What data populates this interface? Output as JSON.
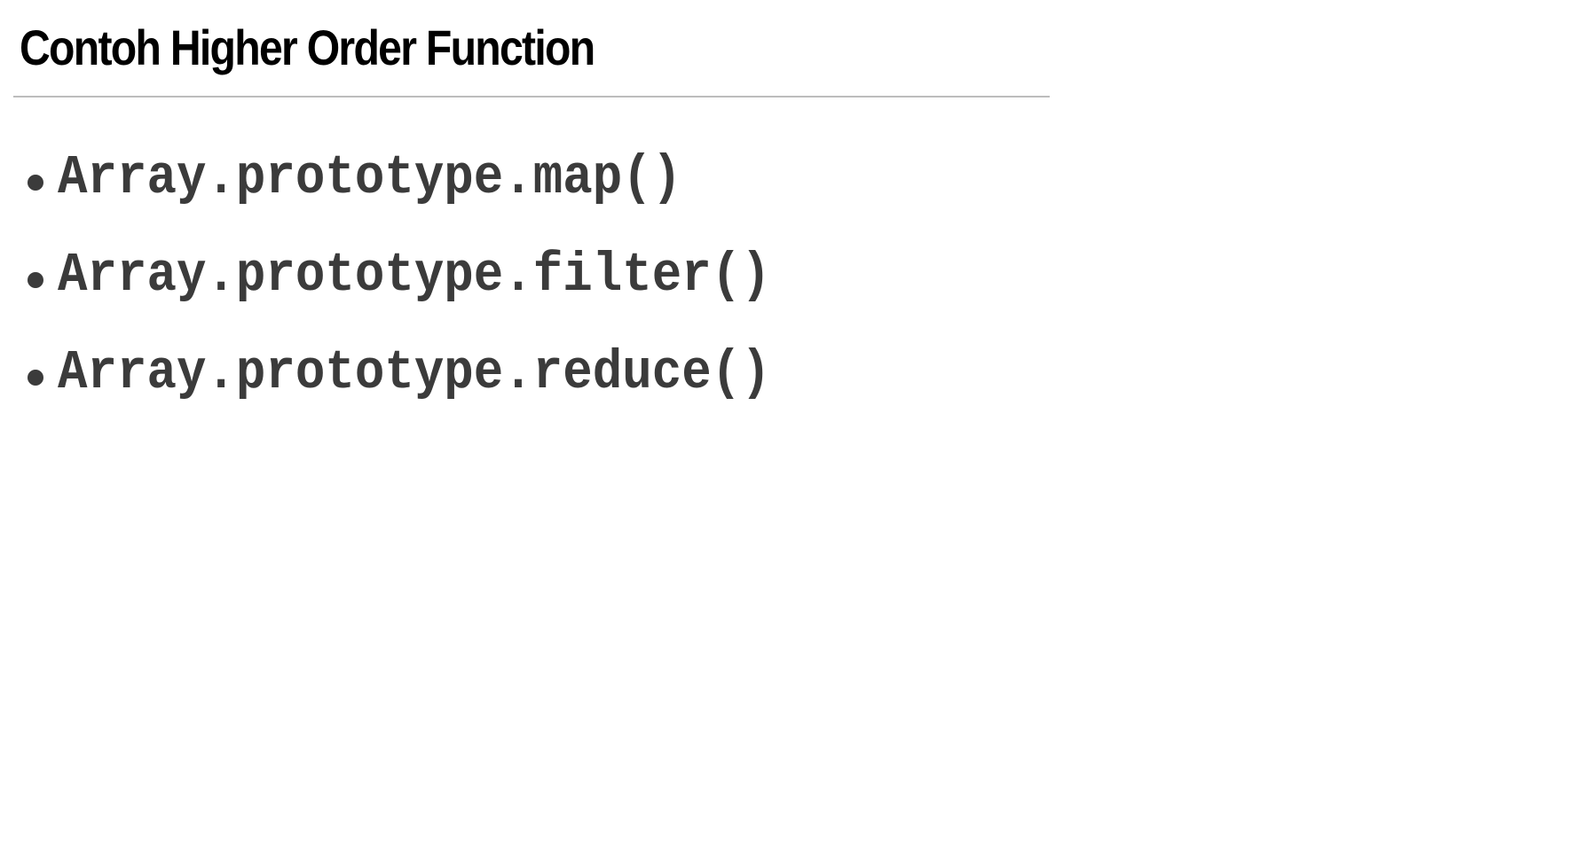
{
  "slide": {
    "title": "Contoh Higher Order Function",
    "bullets": [
      {
        "text": "Array.prototype.map()"
      },
      {
        "text": "Array.prototype.filter()"
      },
      {
        "text": "Array.prototype.reduce()"
      }
    ]
  },
  "colors": {
    "title": "#000000",
    "bullet_text": "#3b3b3b",
    "rule": "#bdbdbd",
    "background": "#ffffff"
  }
}
